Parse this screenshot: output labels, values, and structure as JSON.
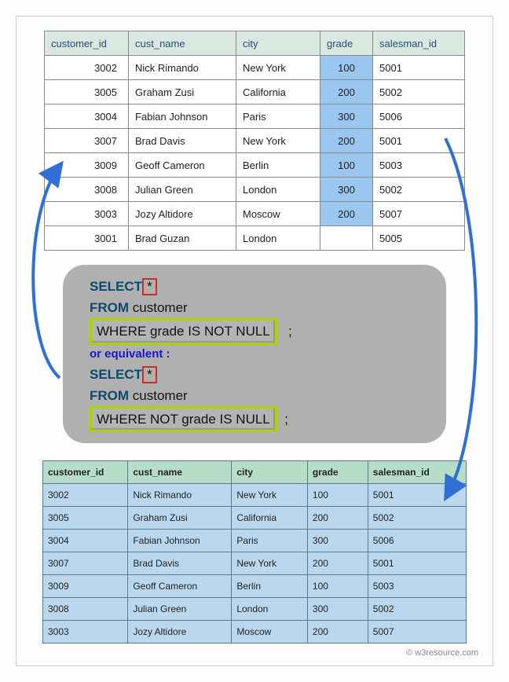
{
  "source_table": {
    "headers": [
      "customer_id",
      "cust_name",
      "city",
      "grade",
      "salesman_id"
    ],
    "rows": [
      {
        "id": "3002",
        "name": "Nick Rimando",
        "city": "New York",
        "grade": "100",
        "sid": "5001",
        "hi": true
      },
      {
        "id": "3005",
        "name": "Graham Zusi",
        "city": "California",
        "grade": "200",
        "sid": "5002",
        "hi": true
      },
      {
        "id": "3004",
        "name": "Fabian Johnson",
        "city": "Paris",
        "grade": "300",
        "sid": "5006",
        "hi": true
      },
      {
        "id": "3007",
        "name": "Brad Davis",
        "city": "New York",
        "grade": "200",
        "sid": "5001",
        "hi": true
      },
      {
        "id": "3009",
        "name": "Geoff Cameron",
        "city": "Berlin",
        "grade": "100",
        "sid": "5003",
        "hi": true
      },
      {
        "id": "3008",
        "name": "Julian Green",
        "city": "London",
        "grade": "300",
        "sid": "5002",
        "hi": true
      },
      {
        "id": "3003",
        "name": "Jozy Altidore",
        "city": "Moscow",
        "grade": "200",
        "sid": "5007",
        "hi": true
      },
      {
        "id": "3001",
        "name": "Brad Guzan",
        "city": "London",
        "grade": "",
        "sid": "5005",
        "hi": false
      }
    ]
  },
  "sql": {
    "select_kw": "SELECT",
    "star": "*",
    "from_kw": "FROM",
    "table": "customer",
    "where1": "WHERE grade IS NOT NULL",
    "semi": ";",
    "or_equiv": "or equivalent :",
    "where2": "WHERE NOT grade IS NULL"
  },
  "result_table": {
    "headers": [
      "customer_id",
      "cust_name",
      "city",
      "grade",
      "salesman_id"
    ],
    "rows": [
      {
        "id": "3002",
        "name": "Nick Rimando",
        "city": "New York",
        "grade": "100",
        "sid": "5001"
      },
      {
        "id": "3005",
        "name": "Graham Zusi",
        "city": "California",
        "grade": "200",
        "sid": "5002"
      },
      {
        "id": "3004",
        "name": "Fabian Johnson",
        "city": "Paris",
        "grade": "300",
        "sid": "5006"
      },
      {
        "id": "3007",
        "name": "Brad Davis",
        "city": "New York",
        "grade": "200",
        "sid": "5001"
      },
      {
        "id": "3009",
        "name": "Geoff Cameron",
        "city": "Berlin",
        "grade": "100",
        "sid": "5003"
      },
      {
        "id": "3008",
        "name": "Julian Green",
        "city": "London",
        "grade": "300",
        "sid": "5002"
      },
      {
        "id": "3003",
        "name": "Jozy Altidore",
        "city": "Moscow",
        "grade": "200",
        "sid": "5007"
      }
    ]
  },
  "copyright": "© w3resource.com",
  "colors": {
    "arrow": "#2f6fd6"
  }
}
